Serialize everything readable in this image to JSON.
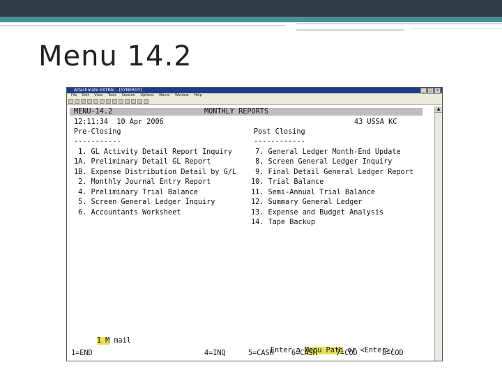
{
  "slide": {
    "title": "Menu 14.2"
  },
  "window": {
    "title": "Attachmate EXTRA! - [SYNERGY]",
    "menu": [
      "File",
      "Edit",
      "View",
      "Tools",
      "Session",
      "Options",
      "Macro",
      "Window",
      "Help"
    ]
  },
  "terminal": {
    "menu_id": "MENU-14.2",
    "menu_title": "MONTHLY REPORTS",
    "datetime": "12:11:34  10 Apr 2006",
    "user": "43 USSA KC",
    "pre_closing": {
      "heading": "Pre-Closing",
      "underline": "-----------",
      "items": [
        " 1. GL Activity Detail Report Inquiry",
        "1A. Preliminary Detail GL Report",
        "1B. Expense Distribution Detail by G/L",
        " 2. Monthly Journal Entry Report",
        " 4. Preliminary Trial Balance",
        " 5. Screen General Ledger Inquiry",
        " 6. Accountants Worksheet"
      ]
    },
    "post_closing": {
      "heading": "Post Closing",
      "underline": "------------",
      "items": [
        " 7. General Ledger Month-End Update",
        " 8. Screen General Ledger Inquiry",
        " 9. Final Detail General Ledger Report",
        "10. Trial Balance",
        "11. Semi-Annual Trial Balance",
        "12. Summary General Ledger",
        "13. Expense and Budget Analysis",
        "14. Tape Backup"
      ]
    },
    "mail_indicator": "1 M",
    "mail_text": "mail",
    "prompt_prefix": "Enter a ",
    "prompt_highlight": "Menu Path",
    "prompt_suffix": " or <Enter>:",
    "function_keys": [
      "1=END",
      "4=INQ",
      "5=CASH",
      "6=CASH",
      "7=COD",
      "8=COD"
    ]
  },
  "colors": {
    "highlight": "#e7e15a",
    "header_bar": "#bdbdbd",
    "title_bar": "#1f3d8a"
  }
}
